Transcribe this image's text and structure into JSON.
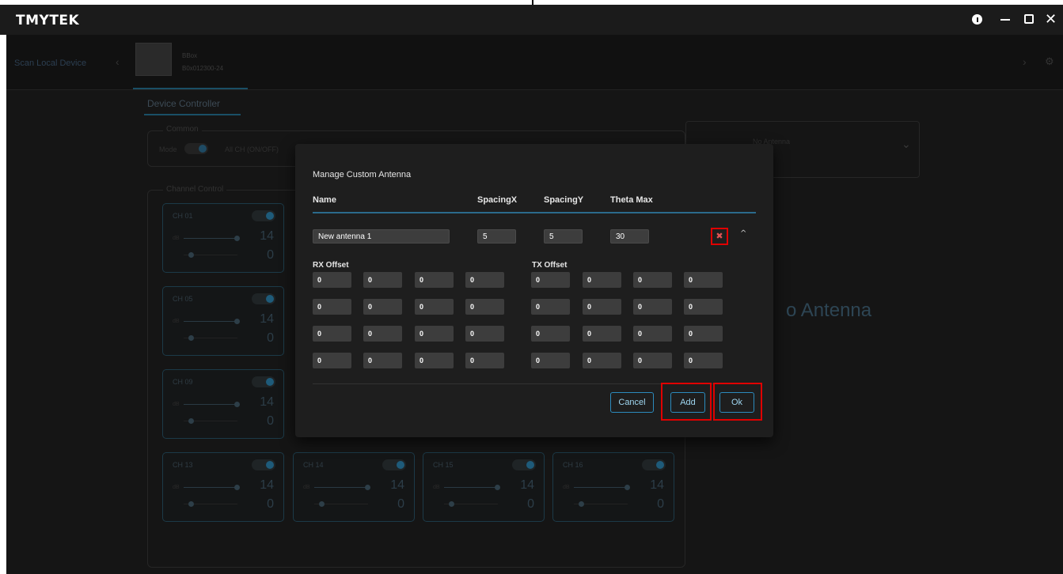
{
  "app": {
    "logo": "TMYTEK",
    "window_controls": [
      "info-icon",
      "minimize-icon",
      "maximize-icon",
      "close-icon"
    ]
  },
  "device_bar": {
    "scan_label": "Scan Local Device",
    "device_name": "BBox",
    "device_sn": "B0x012300-24"
  },
  "tabs": [
    "Device Controller"
  ],
  "background": {
    "common_legend": "Common",
    "mode_label": "Mode",
    "all_ch_label": "All CH (ON/OFF)",
    "channel_legend": "Channel Control",
    "antenna_label": "No Antenna",
    "antenna_big": "o Antenna",
    "channels": [
      {
        "label": "CH 01",
        "v1": "14",
        "v2": "0"
      },
      {
        "label": "CH 05",
        "v1": "14",
        "v2": "0"
      },
      {
        "label": "CH 09",
        "v1": "14",
        "v2": "0"
      },
      {
        "label": "CH 13",
        "v1": "14",
        "v2": "0"
      },
      {
        "label": "CH 14",
        "v1": "14",
        "v2": "0"
      },
      {
        "label": "CH 15",
        "v1": "14",
        "v2": "0"
      },
      {
        "label": "CH 16",
        "v1": "14",
        "v2": "0"
      }
    ]
  },
  "modal": {
    "title": "Manage Custom Antenna",
    "headers": {
      "name": "Name",
      "spacing_x": "SpacingX",
      "spacing_y": "SpacingY",
      "theta_max": "Theta Max"
    },
    "antenna": {
      "name": "New antenna 1",
      "spacing_x": "5",
      "spacing_y": "5",
      "theta_max": "30"
    },
    "rx_label": "RX Offset",
    "tx_label": "TX Offset",
    "rx_offsets": [
      [
        "0",
        "0",
        "0",
        "0"
      ],
      [
        "0",
        "0",
        "0",
        "0"
      ],
      [
        "0",
        "0",
        "0",
        "0"
      ],
      [
        "0",
        "0",
        "0",
        "0"
      ]
    ],
    "tx_offsets": [
      [
        "0",
        "0",
        "0",
        "0"
      ],
      [
        "0",
        "0",
        "0",
        "0"
      ],
      [
        "0",
        "0",
        "0",
        "0"
      ],
      [
        "0",
        "0",
        "0",
        "0"
      ]
    ],
    "buttons": {
      "cancel": "Cancel",
      "add": "Add",
      "ok": "Ok"
    },
    "delete_icon": "close-x-icon",
    "collapse_icon": "chevron-up-icon"
  },
  "colors": {
    "accent": "#2c8bbd",
    "highlight": "#e00000",
    "modal_bg": "#1e1e1e",
    "field_bg": "#3d3d3d"
  }
}
